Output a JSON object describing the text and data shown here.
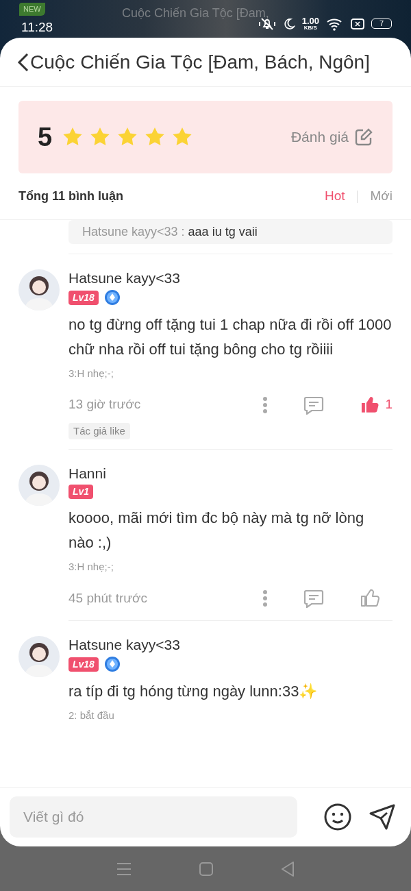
{
  "status_bar": {
    "time": "11:28",
    "speed": "1.00",
    "speed_unit": "KB/S",
    "battery": "7"
  },
  "background": {
    "badge": "NEW",
    "title": "Cuộc Chiến Gia Tộc [Đam,"
  },
  "header": {
    "title": "Cuộc Chiến Gia Tộc [Đam, Bách, Ngôn]"
  },
  "rating": {
    "score": "5",
    "stars": 5,
    "rate_label": "Đánh giá"
  },
  "summary": {
    "total": "Tổng 11 bình luận",
    "sort_tabs": [
      {
        "label": "Hot",
        "selected": true
      },
      {
        "label": "Mới",
        "selected": false
      }
    ]
  },
  "reply_preview": {
    "author": "Hatsune kayy<33 :",
    "text": "aaa iu tg vaii"
  },
  "comments": [
    {
      "name": "Hatsune kayy<33",
      "level": "Lv18",
      "verified": true,
      "text": "no tg đừng off tặng tui 1 chap nữa đi rồi off 1000 chữ nha rồi off tui tặng bông cho tg rồiiii",
      "chapter": "3:H nhẹ;-;",
      "time": "13 giờ trước",
      "liked": true,
      "like_count": "1",
      "tag": "Tác giả like"
    },
    {
      "name": "Hanni",
      "level": "Lv1",
      "verified": false,
      "text": "koooo, mãi mới tìm đc bộ này mà tg nỡ lòng nào :,)",
      "chapter": "3:H nhẹ;-;",
      "time": "45 phút trước",
      "liked": false
    },
    {
      "name": "Hatsune kayy<33",
      "level": "Lv18",
      "verified": true,
      "text": "ra típ đi tg hóng từng ngày lunn:33✨",
      "chapter": "2: bắt đầu"
    }
  ],
  "composer": {
    "placeholder": "Viết gì đó"
  }
}
